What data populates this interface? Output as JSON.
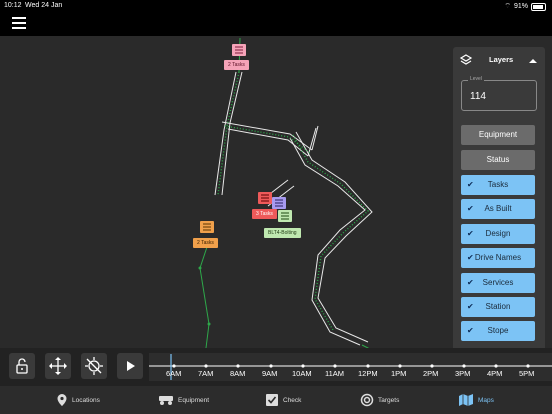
{
  "status": {
    "time": "10:12",
    "date": "Wed 24 Jan",
    "battery": "91%"
  },
  "map": {
    "markers": [
      {
        "label": "2 Tasks",
        "color": "#f5a3b8"
      },
      {
        "label": "2 Tasks",
        "color": "#f0a04b"
      },
      {
        "label": "3 Tasks",
        "color": "#ee5a5a"
      },
      {
        "label": "BLT4-Bolting",
        "color": "#bfe8b0"
      }
    ]
  },
  "panel": {
    "title": "Layers",
    "level_label": "Level",
    "level_value": "114",
    "buttons": [
      {
        "label": "Equipment",
        "active": false
      },
      {
        "label": "Status",
        "active": false
      },
      {
        "label": "Tasks",
        "active": true
      },
      {
        "label": "As Built",
        "active": true
      },
      {
        "label": "Design",
        "active": true
      },
      {
        "label": "Drive Names",
        "active": true
      },
      {
        "label": "Services",
        "active": true
      },
      {
        "label": "Station",
        "active": true
      },
      {
        "label": "Stope",
        "active": true
      }
    ]
  },
  "timeline": {
    "labels": [
      "6AM",
      "7AM",
      "8AM",
      "9AM",
      "10AM",
      "11AM",
      "12PM",
      "1PM",
      "2PM",
      "3PM",
      "4PM",
      "5PM"
    ]
  },
  "tabs": [
    {
      "label": "Locations",
      "icon": "location-pin-icon"
    },
    {
      "label": "Equipment",
      "icon": "truck-icon"
    },
    {
      "label": "Check",
      "icon": "checklist-icon"
    },
    {
      "label": "Targets",
      "icon": "target-icon"
    },
    {
      "label": "Maps",
      "icon": "map-icon",
      "active": true
    }
  ],
  "colors": {
    "accent": "#7cc3f5",
    "route": "#2ea84a",
    "map_bg": "#2a2a2a"
  }
}
